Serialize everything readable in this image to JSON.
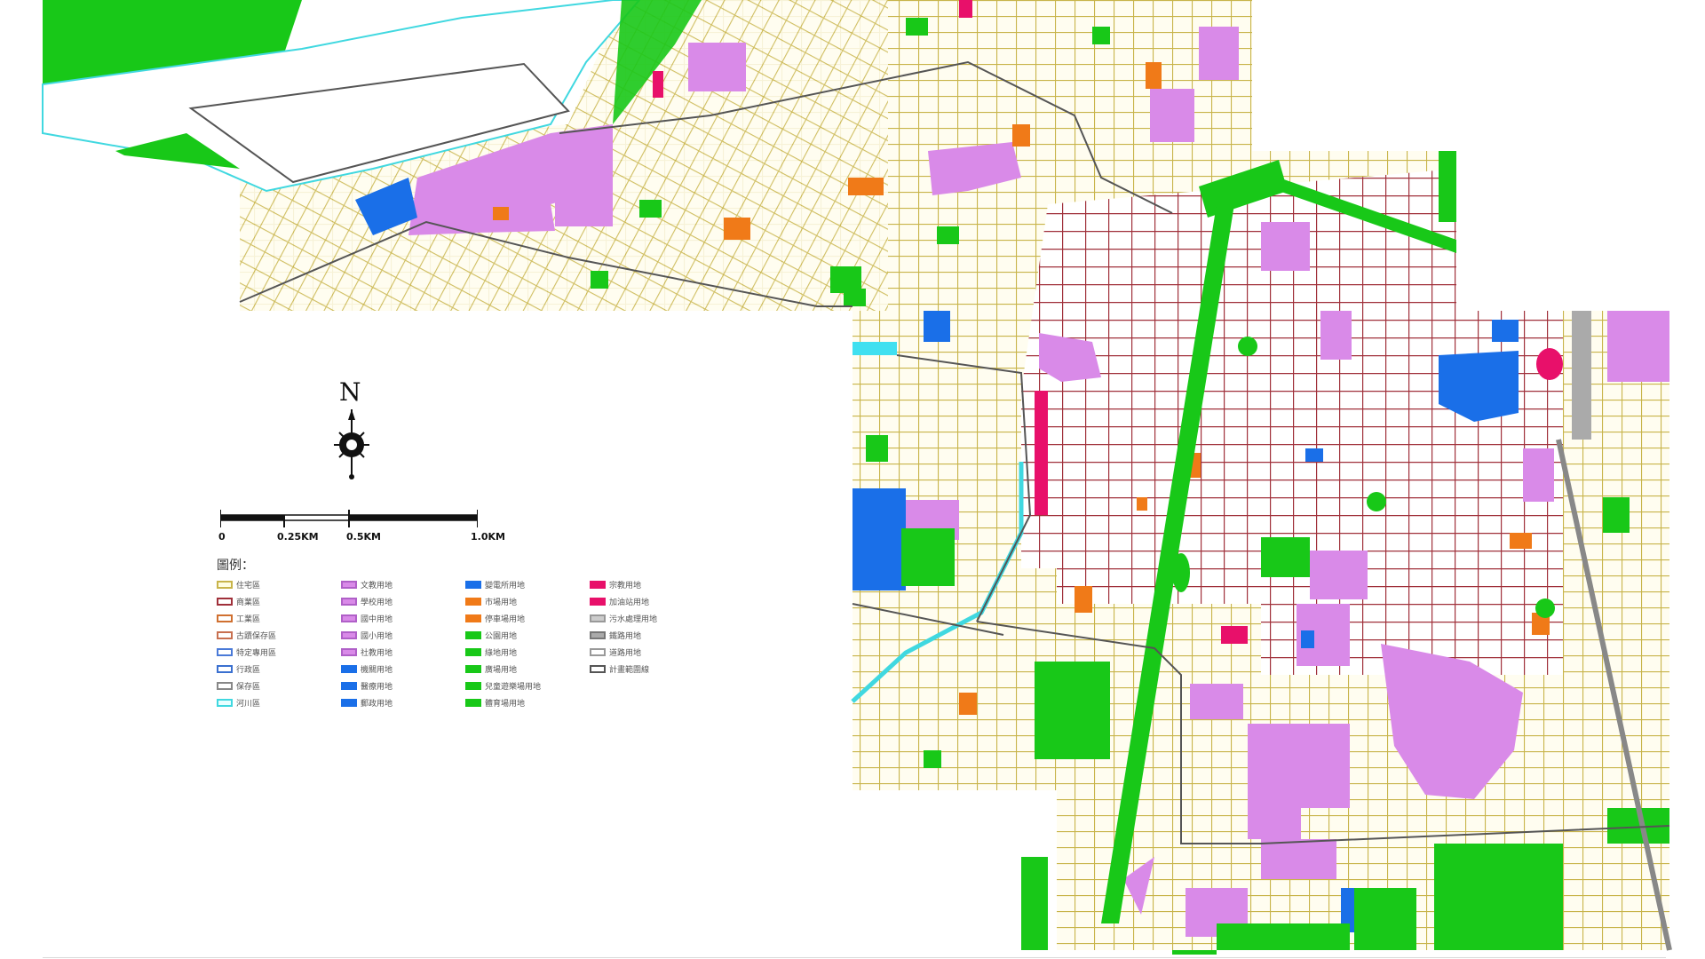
{
  "map": {
    "north_label": "N",
    "scale_labels": [
      "0",
      "0.25KM",
      "0.5KM",
      "1.0KM"
    ],
    "legend_title": "圖例：",
    "legend_items": [
      {
        "label": "住宅區",
        "color": "#fffde0",
        "border": "#c8b44a"
      },
      {
        "label": "商業區",
        "color": "#ffffff",
        "border": "#a0303a"
      },
      {
        "label": "工業區",
        "color": "#ffffff",
        "border": "#d07030"
      },
      {
        "label": "古蹟保存區",
        "color": "#ffffff",
        "border": "#c87050"
      },
      {
        "label": "特定專用區",
        "color": "#ffffff",
        "border": "#4a7ad8"
      },
      {
        "label": "行政區",
        "color": "#ffffff",
        "border": "#3a70d0"
      },
      {
        "label": "保存區",
        "color": "#ffffff",
        "border": "#888888"
      },
      {
        "label": "河川區",
        "color": "#e8ffff",
        "border": "#40d8e0"
      },
      {
        "label": "文教用地",
        "color": "#d98ae8",
        "border": "#b060c8"
      },
      {
        "label": "學校用地",
        "color": "#d98ae8",
        "border": "#b060c8"
      },
      {
        "label": "國中用地",
        "color": "#d98ae8",
        "border": "#b060c8"
      },
      {
        "label": "國小用地",
        "color": "#d98ae8",
        "border": "#b060c8"
      },
      {
        "label": "社教用地",
        "color": "#d98ae8",
        "border": "#b060c8"
      },
      {
        "label": "機關用地",
        "color": "#1a6fe8",
        "border": "#1a6fe8"
      },
      {
        "label": "醫療用地",
        "color": "#1a6fe8",
        "border": "#1a6fe8"
      },
      {
        "label": "郵政用地",
        "color": "#1a6fe8",
        "border": "#1a6fe8"
      },
      {
        "label": "變電所用地",
        "color": "#1a6fe8",
        "border": "#1a6fe8"
      },
      {
        "label": "市場用地",
        "color": "#f07a18",
        "border": "#f07a18"
      },
      {
        "label": "停車場用地",
        "color": "#f07a18",
        "border": "#f07a18"
      },
      {
        "label": "公園用地",
        "color": "#18c818",
        "border": "#18c818"
      },
      {
        "label": "綠地用地",
        "color": "#18c818",
        "border": "#18c818"
      },
      {
        "label": "廣場用地",
        "color": "#18c818",
        "border": "#18c818"
      },
      {
        "label": "兒童遊樂場用地",
        "color": "#18c818",
        "border": "#18c818"
      },
      {
        "label": "體育場用地",
        "color": "#18c818",
        "border": "#18c818"
      },
      {
        "label": "宗教用地",
        "color": "#e8106a",
        "border": "#e8106a"
      },
      {
        "label": "加油站用地",
        "color": "#e8106a",
        "border": "#e8106a"
      },
      {
        "label": "污水處理用地",
        "color": "#cccccc",
        "border": "#999999"
      },
      {
        "label": "鐵路用地",
        "color": "#aaaaaa",
        "border": "#777777"
      },
      {
        "label": "道路用地",
        "color": "#ffffff",
        "border": "#999999"
      },
      {
        "label": "計畫範圍線",
        "color": "#ffffff",
        "border": "#555555"
      }
    ]
  }
}
